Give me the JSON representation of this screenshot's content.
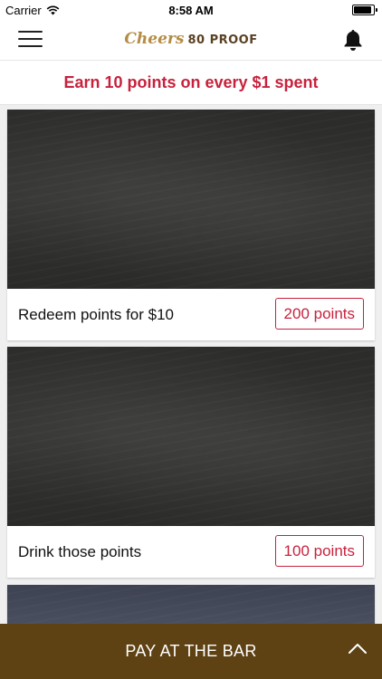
{
  "status_bar": {
    "carrier": "Carrier",
    "time": "8:58 AM",
    "battery_level": 0.9
  },
  "nav": {
    "brand_script": "Cheers",
    "brand_text": "80 PROOF"
  },
  "promo": {
    "text": "Earn 10 points on every $1 spent"
  },
  "rewards": [
    {
      "title": "Redeem points for $10",
      "points": "200 points"
    },
    {
      "title": "Drink those points",
      "points": "100 points"
    }
  ],
  "pay_bar": {
    "label": "PAY AT THE BAR"
  },
  "colors": {
    "accent": "#c8213d",
    "pay_bar": "#5e4214",
    "brand_gold": "#b58c44",
    "brand_brown": "#5a4122"
  },
  "icons": {
    "menu": "hamburger-icon",
    "notifications": "bell-icon",
    "expand": "chevron-up-icon",
    "wifi": "wifi-icon",
    "battery": "battery-icon"
  }
}
